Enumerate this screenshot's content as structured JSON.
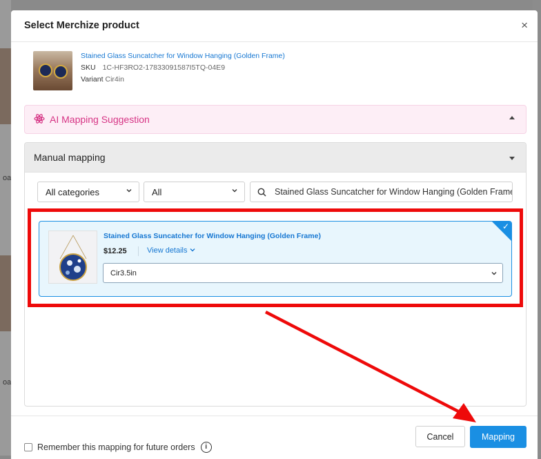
{
  "background": {
    "side_label_1": "oad",
    "side_label_2": "oad"
  },
  "dialog": {
    "title": "Select Merchize product",
    "close_glyph": "×"
  },
  "source_product": {
    "name": "Stained Glass Suncatcher for Window Hanging (Golden Frame)",
    "sku_label": "SKU",
    "sku_value": "1C-HF3RO2-17833091587I5TQ-04E9",
    "variant_label": "Variant",
    "variant_value": "Cir4in"
  },
  "ai_mapping": {
    "title": "AI Mapping Suggestion",
    "color": "#d63384"
  },
  "manual_mapping": {
    "title": "Manual mapping",
    "filters": {
      "category": "All categories",
      "type": "All",
      "search_value": "Stained Glass Suncatcher for Window Hanging (Golden Frame)"
    },
    "result": {
      "name": "Stained Glass Suncatcher for Window Hanging (Golden Frame)",
      "price": "$12.25",
      "view_details": "View details",
      "variant_selected": "Cir3.5in",
      "selected": true
    }
  },
  "footer": {
    "remember_label": "Remember this mapping for future orders",
    "info_glyph": "i",
    "cancel_label": "Cancel",
    "mapping_label": "Mapping"
  },
  "colors": {
    "accent": "#1a8fe3",
    "annotation": "#ee0a0a"
  }
}
